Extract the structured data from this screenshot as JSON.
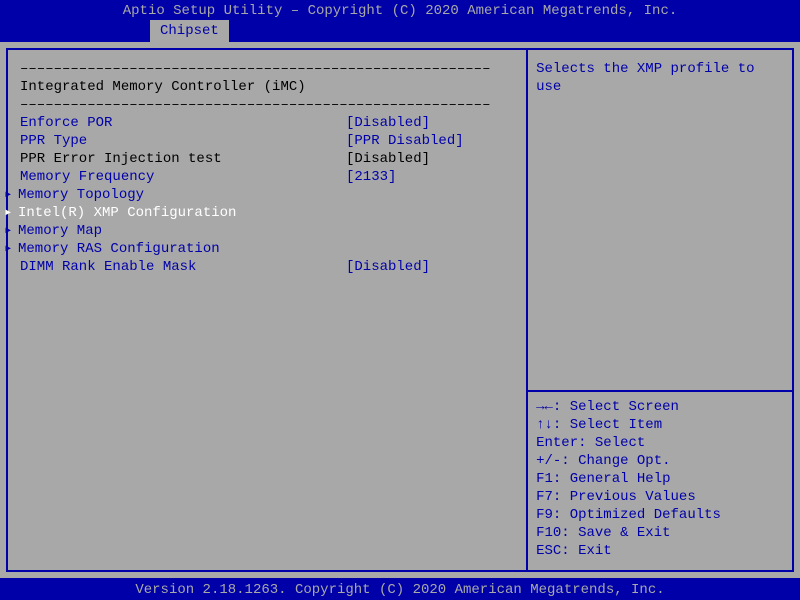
{
  "title": "Aptio Setup Utility – Copyright (C) 2020 American Megatrends, Inc.",
  "tab": "Chipset",
  "section_header": "Integrated Memory Controller (iMC)",
  "dashes": "––––––––––––––––––––––––––––––––––––––––––––––––––––––––",
  "items": [
    {
      "label": "Enforce POR",
      "value": "[Disabled]",
      "style": "blue",
      "arrow": false,
      "selected": false
    },
    {
      "label": "PPR Type",
      "value": "[PPR Disabled]",
      "style": "blue",
      "arrow": false,
      "selected": false
    },
    {
      "label": "PPR Error Injection test",
      "value": "[Disabled]",
      "style": "black",
      "arrow": false,
      "selected": false
    },
    {
      "label": "Memory Frequency",
      "value": "[2133]",
      "style": "blue",
      "arrow": false,
      "selected": false
    },
    {
      "label": "Memory Topology",
      "value": "",
      "style": "blue",
      "arrow": true,
      "selected": false
    },
    {
      "label": "Intel(R) XMP Configuration",
      "value": "",
      "style": "white",
      "arrow": true,
      "selected": true
    },
    {
      "label": "Memory Map",
      "value": "",
      "style": "blue",
      "arrow": true,
      "selected": false
    },
    {
      "label": "Memory RAS Configuration",
      "value": "",
      "style": "blue",
      "arrow": true,
      "selected": false
    },
    {
      "label": "DIMM Rank Enable Mask",
      "value": "[Disabled]",
      "style": "blue",
      "arrow": false,
      "selected": false
    }
  ],
  "help_text": "Selects the XMP profile to use",
  "help_keys": [
    "→←: Select Screen",
    "↑↓: Select Item",
    "Enter: Select",
    "+/-: Change Opt.",
    "F1: General Help",
    "F7: Previous Values",
    "F9: Optimized Defaults",
    "F10: Save & Exit",
    "ESC: Exit"
  ],
  "footer": "Version 2.18.1263. Copyright (C) 2020 American Megatrends, Inc."
}
